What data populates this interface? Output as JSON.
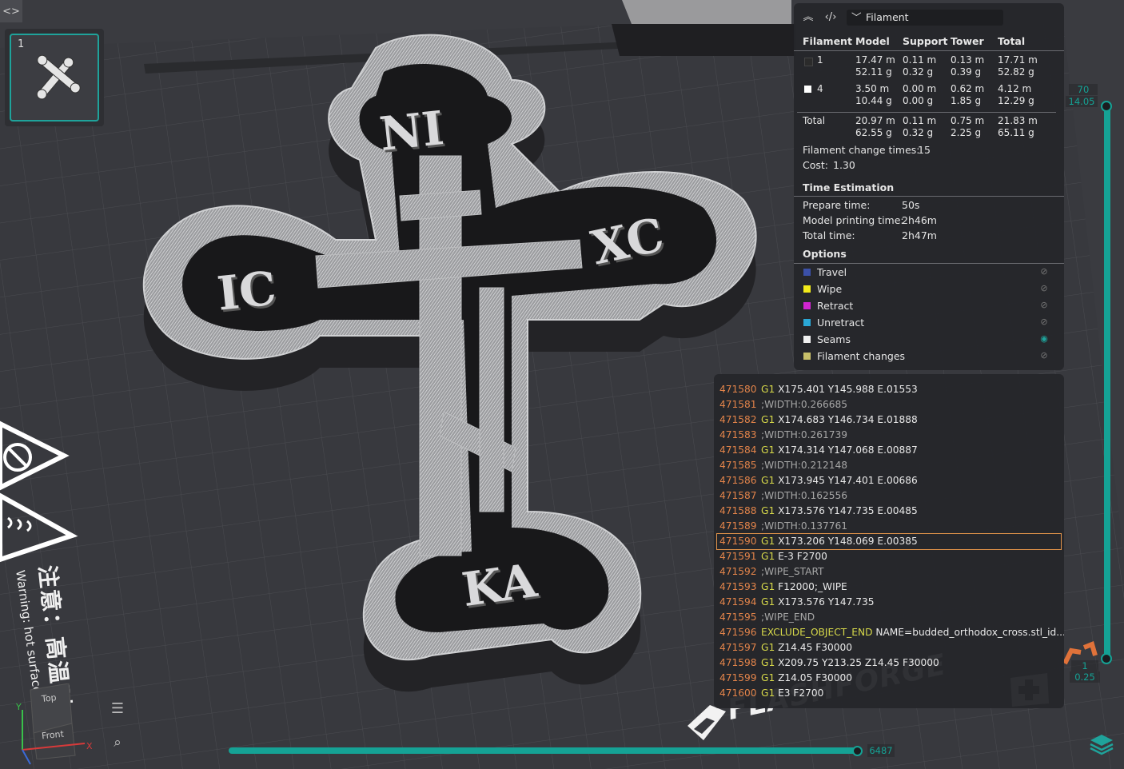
{
  "top_left": {
    "collapse_icon": "code-collapse-icon",
    "plate_number": "1"
  },
  "legend": {
    "header": {
      "collapse_icon": "double-chevron-up-icon",
      "code_icon": "code-icon",
      "view_type": "Filament"
    },
    "columns": [
      "Filament",
      "Model",
      "Support",
      "Tower",
      "Total"
    ],
    "rows": [
      {
        "id": "1",
        "color": "#2b2b2b",
        "model": [
          "17.47 m",
          "52.11 g"
        ],
        "support": [
          "0.11 m",
          "0.32 g"
        ],
        "tower": [
          "0.13 m",
          "0.39 g"
        ],
        "total": [
          "17.71 m",
          "52.82 g"
        ]
      },
      {
        "id": "4",
        "color": "#ffffff",
        "model": [
          "3.50 m",
          "10.44 g"
        ],
        "support": [
          "0.00 m",
          "0.00 g"
        ],
        "tower": [
          "0.62 m",
          "1.85 g"
        ],
        "total": [
          "4.12 m",
          "12.29 g"
        ]
      }
    ],
    "total_row": {
      "label": "Total",
      "model": [
        "20.97 m",
        "62.55 g"
      ],
      "support": [
        "0.11 m",
        "0.32 g"
      ],
      "tower": [
        "0.75 m",
        "2.25 g"
      ],
      "total": [
        "21.83 m",
        "65.11 g"
      ]
    },
    "filament_change_label": "Filament change times:",
    "filament_change_value": "15",
    "cost_label": "Cost:",
    "cost_value": "1.30",
    "time_title": "Time Estimation",
    "prepare_label": "Prepare time:",
    "prepare_value": "50s",
    "model_time_label": "Model printing time:",
    "model_time_value": "2h46m",
    "total_time_label": "Total time:",
    "total_time_value": "2h47m",
    "options_title": "Options",
    "options": [
      {
        "label": "Travel",
        "color": "#3b50a8",
        "visible": false
      },
      {
        "label": "Wipe",
        "color": "#f2ea1a",
        "visible": false
      },
      {
        "label": "Retract",
        "color": "#d225d2",
        "visible": false
      },
      {
        "label": "Unretract",
        "color": "#2aa7d6",
        "visible": false
      },
      {
        "label": "Seams",
        "color": "#f0f0f0",
        "visible": true
      },
      {
        "label": "Filament changes",
        "color": "#c8c06a",
        "visible": false
      }
    ]
  },
  "gcode": {
    "selected_line": "471590",
    "lines": [
      {
        "n": "471580",
        "cmd": "G1",
        "rest": "X175.401 Y145.988 E.01553"
      },
      {
        "n": "471581",
        "cmd": "",
        "rest": ";WIDTH:0.266685"
      },
      {
        "n": "471582",
        "cmd": "G1",
        "rest": "X174.683 Y146.734 E.01888"
      },
      {
        "n": "471583",
        "cmd": "",
        "rest": ";WIDTH:0.261739"
      },
      {
        "n": "471584",
        "cmd": "G1",
        "rest": "X174.314 Y147.068 E.00887"
      },
      {
        "n": "471585",
        "cmd": "",
        "rest": ";WIDTH:0.212148"
      },
      {
        "n": "471586",
        "cmd": "G1",
        "rest": "X173.945 Y147.401 E.00686"
      },
      {
        "n": "471587",
        "cmd": "",
        "rest": ";WIDTH:0.162556"
      },
      {
        "n": "471588",
        "cmd": "G1",
        "rest": "X173.576 Y147.735 E.00485"
      },
      {
        "n": "471589",
        "cmd": "",
        "rest": ";WIDTH:0.137761"
      },
      {
        "n": "471590",
        "cmd": "G1",
        "rest": "X173.206 Y148.069 E.00385"
      },
      {
        "n": "471591",
        "cmd": "G1",
        "rest": "E-3 F2700"
      },
      {
        "n": "471592",
        "cmd": "",
        "rest": ";WIPE_START"
      },
      {
        "n": "471593",
        "cmd": "G1",
        "rest": "F12000;_WIPE"
      },
      {
        "n": "471594",
        "cmd": "G1",
        "rest": "X173.576 Y147.735"
      },
      {
        "n": "471595",
        "cmd": "",
        "rest": ";WIPE_END"
      },
      {
        "n": "471596",
        "cmd": "EXCLUDE_OBJECT_END",
        "rest": "NAME=budded_orthodox_cross.stl_id..."
      },
      {
        "n": "471597",
        "cmd": "G1",
        "rest": "Z14.45 F30000"
      },
      {
        "n": "471598",
        "cmd": "G1",
        "rest": "X209.75 Y213.25 Z14.45 F30000"
      },
      {
        "n": "471599",
        "cmd": "G1",
        "rest": "Z14.05 F30000"
      },
      {
        "n": "471600",
        "cmd": "G1",
        "rest": "E3 F2700"
      }
    ]
  },
  "layer_slider": {
    "top_layer": "70",
    "top_height": "14.05",
    "bottom_layer": "1",
    "bottom_height": "0.25"
  },
  "move_slider": {
    "value": "6487",
    "position_fraction": 0.99
  },
  "model_labels": {
    "top": "NI",
    "left": "IC",
    "right": "XC",
    "bottom": "KA"
  },
  "bed": {
    "brand": "FLASHFORGE",
    "warning_cn": "注意：高温时",
    "warning_en": "Warning: hot surface,"
  },
  "orientation": {
    "top": "Top",
    "front": "Front",
    "x": "X",
    "y": "Y"
  },
  "icons": {
    "menu": "hamburger-icon",
    "zoom": "zoom-icon",
    "layers": "layers-icon"
  }
}
